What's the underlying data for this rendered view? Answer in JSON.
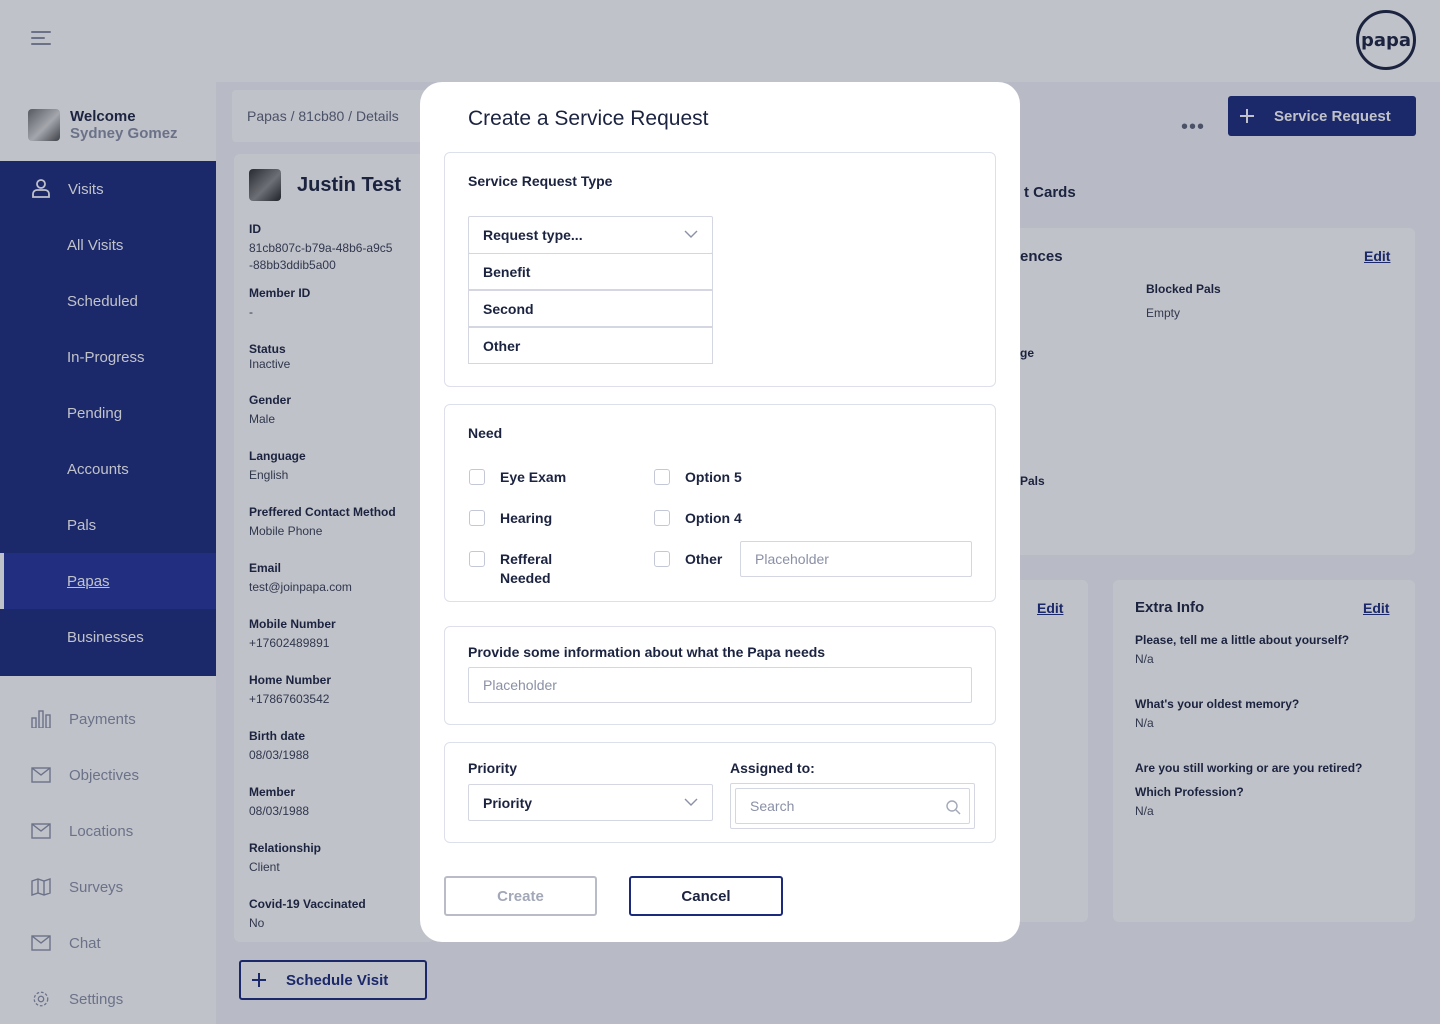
{
  "brand": {
    "logo_text": "papa",
    "primary_color": "#1b2a7a"
  },
  "sidebar": {
    "welcome": "Welcome",
    "user_name": "Sydney Gomez",
    "items": [
      {
        "label": "Visits",
        "icon": "person-icon"
      },
      {
        "label": "All Visits"
      },
      {
        "label": "Scheduled"
      },
      {
        "label": "In-Progress"
      },
      {
        "label": "Pending"
      },
      {
        "label": "Accounts"
      },
      {
        "label": "Pals"
      },
      {
        "label": "Papas",
        "active": true
      },
      {
        "label": "Businesses"
      }
    ],
    "secondary": [
      {
        "label": "Payments",
        "icon": "bar-chart-icon"
      },
      {
        "label": "Objectives",
        "icon": "mail-icon"
      },
      {
        "label": "Locations",
        "icon": "mail-icon"
      },
      {
        "label": "Surveys",
        "icon": "map-icon"
      },
      {
        "label": "Chat",
        "icon": "mail-icon"
      },
      {
        "label": "Settings",
        "icon": "gear-icon"
      }
    ]
  },
  "header": {
    "breadcrumb": "Papas / 81cb80 / Details",
    "service_request_button": "Service Request"
  },
  "profile": {
    "name": "Justin Test",
    "fields": [
      {
        "key": "ID",
        "value": "81cb807c-b79a-48b6-a9c5\n-88bb3ddib5a00"
      },
      {
        "key": "Member ID",
        "value": "-"
      },
      {
        "key": "Status",
        "value": "Inactive"
      },
      {
        "key": "Gender",
        "value": "Male"
      },
      {
        "key": "Language",
        "value": "English"
      },
      {
        "key": "Preffered Contact Method",
        "value": "Mobile Phone"
      },
      {
        "key": "Email",
        "value": "test@joinpapa.com"
      },
      {
        "key": "Mobile Number",
        "value": "+17602489891"
      },
      {
        "key": "Home Number",
        "value": "+17867603542"
      },
      {
        "key": "Birth date",
        "value": "08/03/1988"
      },
      {
        "key": "Member",
        "value": "08/03/1988"
      },
      {
        "key": "Relationship",
        "value": "Client"
      },
      {
        "key": "Covid-19 Vaccinated",
        "value": "No"
      }
    ],
    "schedule_visit_button": "Schedule Visit"
  },
  "right_panel": {
    "tab_partial": "t Cards",
    "preferences_partial": "ences",
    "edit_label": "Edit",
    "blocked_pals_label": "Blocked Pals",
    "blocked_pals_value": "Empty",
    "partial_ge": "ge",
    "partial_pals": "e Pals",
    "extra_info": {
      "title": "Extra Info",
      "questions": [
        {
          "q": "Please, tell me a little about yourself?",
          "a": "N/a"
        },
        {
          "q": "What's your oldest memory?",
          "a": "N/a"
        },
        {
          "q": "Are you still working or are you retired?\nWhich Profession?",
          "a": "N/a"
        }
      ]
    }
  },
  "modal": {
    "title": "Create a Service Request",
    "request_type": {
      "heading": "Service Request Type",
      "select_placeholder": "Request type...",
      "options": [
        "Benefit",
        "Second",
        "Other"
      ]
    },
    "need": {
      "heading": "Need",
      "options_left": [
        "Eye Exam",
        "Hearing",
        "Refferal\nNeeded"
      ],
      "options_right": [
        "Option 5",
        "Option 4",
        "Other"
      ],
      "other_placeholder": "Placeholder"
    },
    "info": {
      "heading": "Provide some information about what the Papa needs",
      "placeholder": "Placeholder"
    },
    "priority": {
      "heading": "Priority",
      "select_value": "Priority",
      "assigned_heading": "Assigned to:",
      "search_placeholder": "Search"
    },
    "create_button": "Create",
    "cancel_button": "Cancel"
  }
}
